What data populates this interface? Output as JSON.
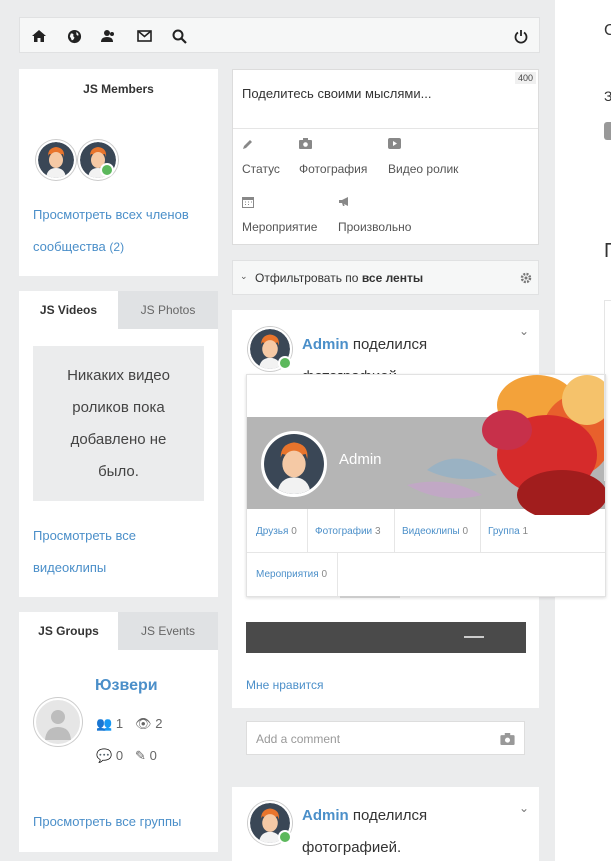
{
  "toolbar": {
    "icons": [
      "home-icon",
      "globe-icon",
      "users-icon",
      "envelope-icon",
      "search-icon",
      "power-icon"
    ]
  },
  "members": {
    "title": "JS Members",
    "view_all": "Просмотреть всех членов сообщества",
    "count": "(2)"
  },
  "media_tabs": {
    "videos_label": "JS Videos",
    "photos_label": "JS Photos",
    "empty_message": "Никаких видео роликов пока добавлено не было.",
    "view_all": "Просмотреть все видеоклипы"
  },
  "groups_tabs": {
    "groups_label": "JS Groups",
    "events_label": "JS Events",
    "group_name": "Юзвери",
    "stats": {
      "members": "1",
      "views": "2",
      "comments": "0",
      "edits": "0"
    },
    "view_all": "Просмотреть все группы"
  },
  "composer": {
    "placeholder": "Поделитесь своими мыслями...",
    "char_limit": "400",
    "actions": {
      "status": "Статус",
      "photo": "Фотография",
      "video": "Видео ролик",
      "event": "Мероприятие",
      "custom": "Произвольно"
    }
  },
  "filter": {
    "prefix": "Отфильтровать по",
    "value": "все ленты"
  },
  "post1": {
    "author": "Admin",
    "action": "поделился фотографией.",
    "card_name": "Admin",
    "links": [
      {
        "label": "Друзья",
        "count": "0"
      },
      {
        "label": "Фотографии",
        "count": "3"
      },
      {
        "label": "Видеоклипы",
        "count": "0"
      },
      {
        "label": "Группа",
        "count": "1"
      },
      {
        "label": "Мероприятия",
        "count": "0"
      }
    ],
    "like": "Мне нравится",
    "comment_placeholder": "Add a comment"
  },
  "post2": {
    "author": "Admin",
    "action": "поделился фотографией."
  },
  "right": {
    "letters": [
      "С",
      "З",
      "П"
    ]
  },
  "colors": {
    "link": "#4b8fc9",
    "online": "#5cb85c",
    "panel_bg": "#ebeced",
    "card_gray": "#b5b5b5"
  }
}
